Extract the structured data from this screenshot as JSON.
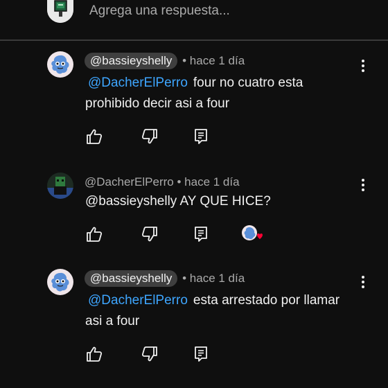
{
  "reply_bar": {
    "placeholder": "Agrega una respuesta..."
  },
  "comments": [
    {
      "handle": "@bassieyshelly",
      "handle_style": "pill",
      "time": "• hace 1 día",
      "mention": "@DacherElPerro",
      "text": "four no cuatro esta prohibido decir asi a four",
      "avatar": "blue-character-avatar",
      "creator_heart": false
    },
    {
      "handle": "@DacherElPerro",
      "handle_style": "plain",
      "time": "• hace 1 día",
      "mention": "",
      "text": "@bassieyshelly  AY QUE HICE?",
      "avatar": "dark-green-character-avatar",
      "creator_heart": true
    },
    {
      "handle": "@bassieyshelly",
      "handle_style": "pill",
      "time": "• hace 1 día",
      "mention": "@DacherElPerro",
      "text": "esta arrestado por llamar asi a four",
      "avatar": "blue-character-avatar",
      "creator_heart": false
    }
  ],
  "icons": {
    "like": "thumbs-up-icon",
    "dislike": "thumbs-down-icon",
    "reply": "reply-comment-icon",
    "more": "more-vert-icon",
    "heart": "creator-heart-icon"
  },
  "colors": {
    "background": "#0f0f0f",
    "mention": "#3ea6ff",
    "muted": "#aaaaaa",
    "pill": "#3f3f3f",
    "heart": "#ff0033"
  }
}
